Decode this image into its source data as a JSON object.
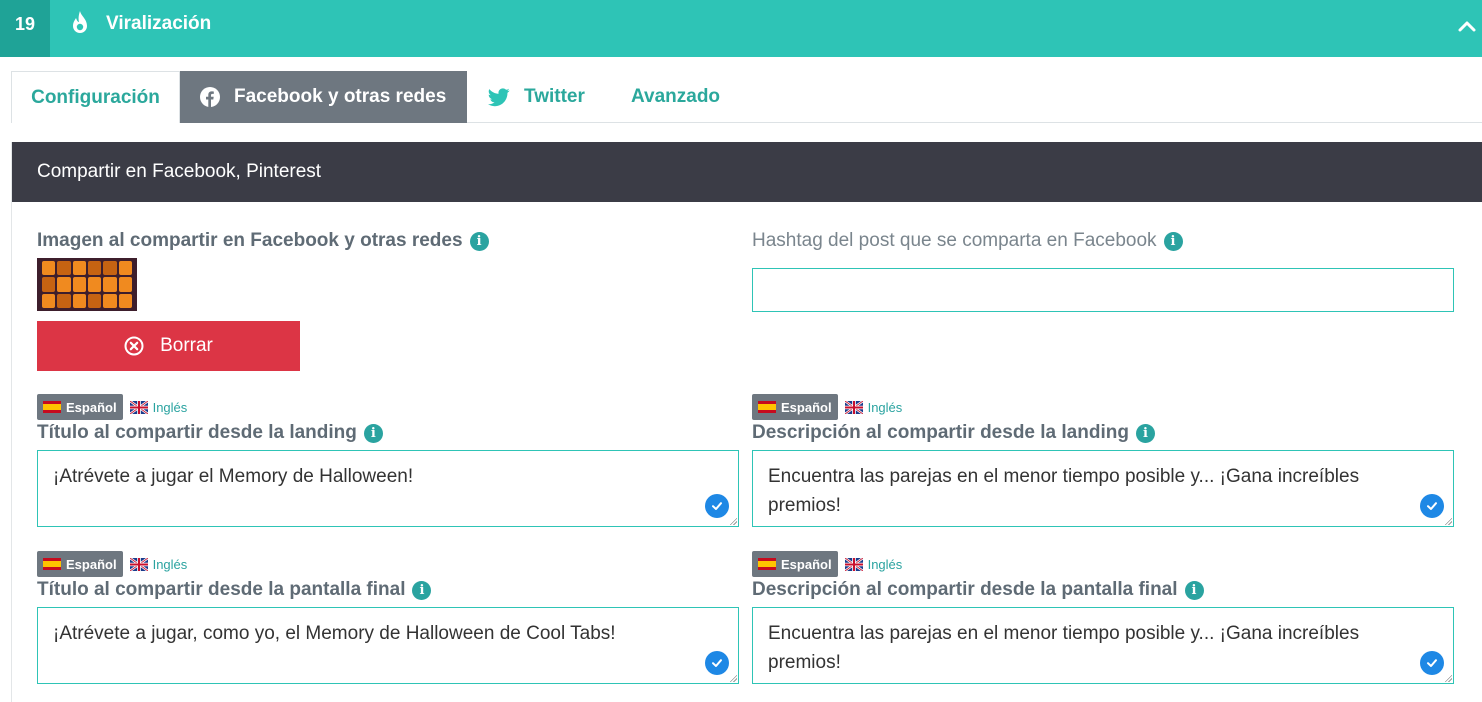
{
  "header": {
    "step": "19",
    "title": "Viralización",
    "icon": "fire-icon",
    "collapse_icon": "chevron-up-icon"
  },
  "tabs": [
    {
      "label": "Configuración"
    },
    {
      "label": "Facebook y otras redes",
      "icon": "facebook-icon",
      "active": true
    },
    {
      "label": "Twitter",
      "icon": "twitter-icon"
    },
    {
      "label": "Avanzado"
    }
  ],
  "panel": {
    "title": "Compartir en Facebook, Pinterest"
  },
  "image_field": {
    "label": "Imagen al compartir en Facebook y otras redes",
    "delete_label": "Borrar"
  },
  "hashtag_field": {
    "label": "Hashtag del post que se comparta en Facebook",
    "value": ""
  },
  "languages": {
    "active": "Español",
    "other": "Inglés"
  },
  "fields": {
    "title_landing": {
      "label": "Título al compartir desde la landing",
      "value": "¡Atrévete a jugar el Memory de Halloween!"
    },
    "desc_landing": {
      "label": "Descripción al compartir desde la landing",
      "value": "Encuentra las parejas en el menor tiempo posible y... ¡Gana increíbles premios!"
    },
    "title_final": {
      "label": "Título al compartir desde la pantalla final",
      "value": "¡Atrévete a jugar, como yo, el Memory de Halloween de Cool Tabs!"
    },
    "desc_final": {
      "label": "Descripción al compartir desde la pantalla final",
      "value": "Encuentra las parejas en el menor tiempo posible y... ¡Gana increíbles premios!"
    }
  },
  "colors": {
    "accent": "#2ec4b6",
    "danger": "#dc3545",
    "dark": "#3b3c46",
    "tab_active": "#6e7780"
  }
}
